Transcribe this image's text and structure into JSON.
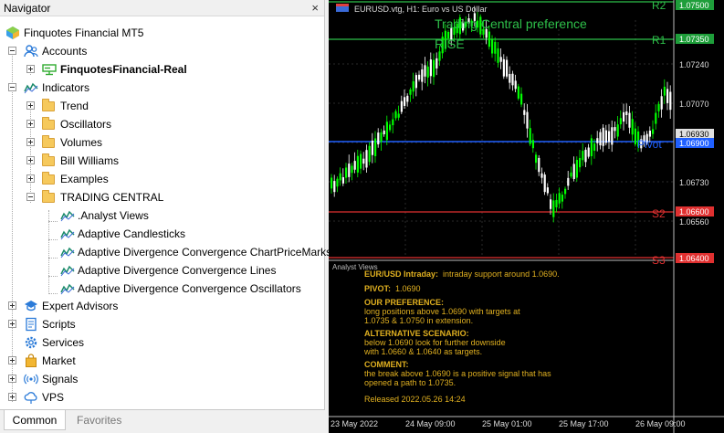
{
  "navigator": {
    "title": "Navigator",
    "close": "×",
    "root": "Finquotes Financial MT5",
    "accounts": {
      "label": "Accounts",
      "items": [
        "FinquotesFinancial-Real"
      ]
    },
    "indicators": {
      "label": "Indicators",
      "folders": [
        "Trend",
        "Oscillators",
        "Volumes",
        "Bill Williams",
        "Examples"
      ],
      "trading_central": {
        "label": "TRADING CENTRAL",
        "items": [
          ".Analyst Views",
          "Adaptive Candlesticks",
          "Adaptive Divergence Convergence ChartPriceMarks",
          "Adaptive Divergence Convergence Lines",
          "Adaptive Divergence Convergence Oscillators"
        ]
      }
    },
    "bottom": [
      "Expert Advisors",
      "Scripts",
      "Services",
      "Market",
      "Signals",
      "VPS"
    ],
    "tabs": [
      "Common",
      "Favorites"
    ]
  },
  "chart": {
    "symbol_line": "EURUSD.vtg, H1:  Euro vs US Dollar",
    "overlay_title": "Trading Central preference",
    "overlay_sub": "RISE",
    "level_labels": {
      "r2": "R2",
      "r1": "R1",
      "pivot": "Pivot",
      "s2": "S2",
      "s3": "S3"
    },
    "price_labels": [
      "1.07500",
      "1.07350",
      "1.07240",
      "1.07070",
      "1.06930",
      "1.06900",
      "1.06730",
      "1.06600",
      "1.06560",
      "1.06400"
    ],
    "time_labels": [
      "23 May 2022",
      "24 May 09:00",
      "25 May 01:00",
      "25 May 17:00",
      "26 May 09:00"
    ],
    "colors": {
      "up": "#00ff00",
      "down": "#ffffff",
      "r": "#2ec04a",
      "s": "#e03030",
      "pivot": "#2060ff"
    }
  },
  "analyst": {
    "title": "Analyst Views",
    "intraday_label": "EUR/USD Intraday:",
    "intraday_text": "intraday support around 1.0690.",
    "pivot_label": "PIVOT:",
    "pivot_value": "1.0690",
    "pref_label": "OUR PREFERENCE:",
    "pref_line1": "long positions above 1.0690 with targets at",
    "pref_line2": "1.0735 & 1.0750 in extension.",
    "alt_label": "ALTERNATIVE SCENARIO:",
    "alt_line1": "below 1.0690 look for further downside",
    "alt_line2": "with 1.0660 & 1.0640 as targets.",
    "comment_label": "COMMENT:",
    "comment_line1": "the break above 1.0690 is a positive signal that has",
    "comment_line2": "opened a path to 1.0735.",
    "released": "Released 2022.05.26 14:24"
  }
}
